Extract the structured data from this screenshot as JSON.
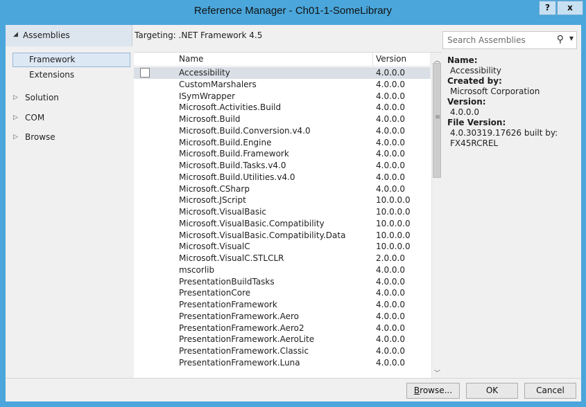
{
  "window": {
    "title": "Reference Manager - Ch01-1-SomeLibrary",
    "help_label": "?",
    "close_label": "x"
  },
  "nav": {
    "header": {
      "label": "Assemblies",
      "expander": "◢"
    },
    "sub_items": [
      {
        "label": "Framework",
        "selected": true
      },
      {
        "label": "Extensions",
        "selected": false
      }
    ],
    "groups": [
      {
        "label": "Solution",
        "expander": "▷"
      },
      {
        "label": "COM",
        "expander": "▷"
      },
      {
        "label": "Browse",
        "expander": "▷"
      }
    ]
  },
  "targeting": {
    "label": "Targeting: .NET Framework 4.5"
  },
  "search": {
    "placeholder": "Search Assemblies",
    "icon": "search-icon"
  },
  "list": {
    "columns": {
      "name": "Name",
      "version": "Version"
    },
    "rows": [
      {
        "name": "Accessibility",
        "version": "4.0.0.0"
      },
      {
        "name": "CustomMarshalers",
        "version": "4.0.0.0"
      },
      {
        "name": "ISymWrapper",
        "version": "4.0.0.0"
      },
      {
        "name": "Microsoft.Activities.Build",
        "version": "4.0.0.0"
      },
      {
        "name": "Microsoft.Build",
        "version": "4.0.0.0"
      },
      {
        "name": "Microsoft.Build.Conversion.v4.0",
        "version": "4.0.0.0"
      },
      {
        "name": "Microsoft.Build.Engine",
        "version": "4.0.0.0"
      },
      {
        "name": "Microsoft.Build.Framework",
        "version": "4.0.0.0"
      },
      {
        "name": "Microsoft.Build.Tasks.v4.0",
        "version": "4.0.0.0"
      },
      {
        "name": "Microsoft.Build.Utilities.v4.0",
        "version": "4.0.0.0"
      },
      {
        "name": "Microsoft.CSharp",
        "version": "4.0.0.0"
      },
      {
        "name": "Microsoft.JScript",
        "version": "10.0.0.0"
      },
      {
        "name": "Microsoft.VisualBasic",
        "version": "10.0.0.0"
      },
      {
        "name": "Microsoft.VisualBasic.Compatibility",
        "version": "10.0.0.0"
      },
      {
        "name": "Microsoft.VisualBasic.Compatibility.Data",
        "version": "10.0.0.0"
      },
      {
        "name": "Microsoft.VisualC",
        "version": "10.0.0.0"
      },
      {
        "name": "Microsoft.VisualC.STLCLR",
        "version": "2.0.0.0"
      },
      {
        "name": "mscorlib",
        "version": "4.0.0.0"
      },
      {
        "name": "PresentationBuildTasks",
        "version": "4.0.0.0"
      },
      {
        "name": "PresentationCore",
        "version": "4.0.0.0"
      },
      {
        "name": "PresentationFramework",
        "version": "4.0.0.0"
      },
      {
        "name": "PresentationFramework.Aero",
        "version": "4.0.0.0"
      },
      {
        "name": "PresentationFramework.Aero2",
        "version": "4.0.0.0"
      },
      {
        "name": "PresentationFramework.AeroLite",
        "version": "4.0.0.0"
      },
      {
        "name": "PresentationFramework.Classic",
        "version": "4.0.0.0"
      },
      {
        "name": "PresentationFramework.Luna",
        "version": "4.0.0.0"
      }
    ],
    "selected_index": 0
  },
  "details": {
    "name_label": "Name:",
    "name_value": "Accessibility",
    "created_label": "Created by:",
    "created_value": "Microsoft Corporation",
    "version_label": "Version:",
    "version_value": "4.0.0.0",
    "file_version_label": "File Version:",
    "file_version_value_1": "4.0.30319.17626 built by:",
    "file_version_value_2": "FX45RCREL"
  },
  "footer": {
    "browse_label": "Browse...",
    "browse_hotkey": "B",
    "browse_rest": "rowse...",
    "ok_label": "OK",
    "cancel_label": "Cancel"
  },
  "colors": {
    "chrome": "#4aa6db",
    "selection": "#dadfe6",
    "nav_header": "#dde5ef"
  }
}
